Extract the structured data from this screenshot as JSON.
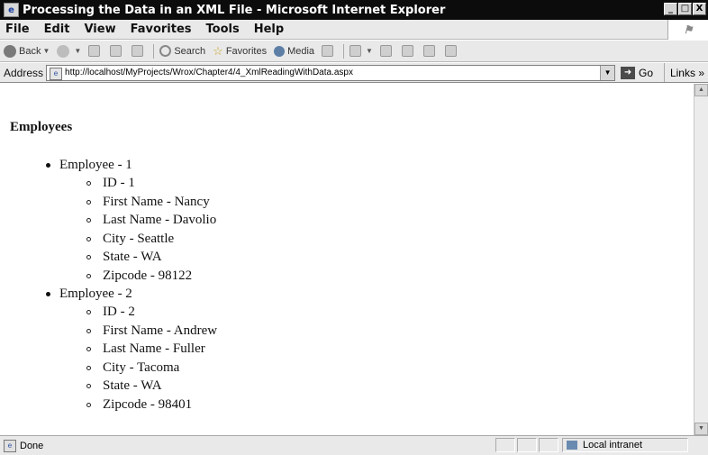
{
  "window": {
    "title": "Processing the Data in an XML File - Microsoft Internet Explorer",
    "controls": [
      "_",
      "□",
      "X"
    ]
  },
  "menu": {
    "items": [
      "File",
      "Edit",
      "View",
      "Favorites",
      "Tools",
      "Help"
    ]
  },
  "toolbar": {
    "back_label": "Back",
    "search_label": "Search",
    "favorites_label": "Favorites",
    "media_label": "Media"
  },
  "address": {
    "label": "Address",
    "url": "http://localhost/MyProjects/Wrox/Chapter4/4_XmlReadingWithData.aspx",
    "go_label": "Go",
    "links_label": "Links »"
  },
  "page": {
    "heading": "Employees",
    "employees": [
      {
        "label": "Employee - 1",
        "fields": [
          "ID - 1",
          "First Name - Nancy",
          "Last Name - Davolio",
          "City - Seattle",
          "State - WA",
          "Zipcode - 98122"
        ]
      },
      {
        "label": "Employee - 2",
        "fields": [
          "ID - 2",
          "First Name - Andrew",
          "Last Name - Fuller",
          "City - Tacoma",
          "State - WA",
          "Zipcode - 98401"
        ]
      }
    ]
  },
  "status": {
    "text": "Done",
    "zone": "Local intranet"
  }
}
